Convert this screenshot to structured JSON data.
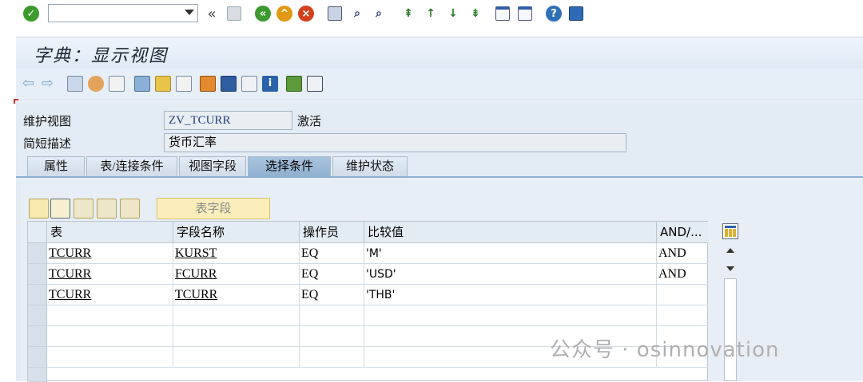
{
  "system_toolbar": {
    "command_value": "",
    "icons": [
      "check-icon",
      "back-chevrons-icon",
      "save-icon",
      "back-icon",
      "exit-icon",
      "cancel-icon",
      "print-icon",
      "find-icon",
      "find-next-icon",
      "first-page-icon",
      "prev-page-icon",
      "next-page-icon",
      "last-page-icon",
      "new-session-icon",
      "shortcut-icon",
      "help-icon",
      "customize-layout-icon"
    ]
  },
  "title": "字典：显示视图",
  "form": {
    "view_label": "维护视图",
    "view_value": "ZV_TCURR",
    "view_status": "激活",
    "desc_label": "简短描述",
    "desc_value": "货币汇率"
  },
  "tabs": [
    {
      "label": "属性",
      "active": false
    },
    {
      "label": "表/连接条件",
      "active": false
    },
    {
      "label": "视图字段",
      "active": false
    },
    {
      "label": "选择条件",
      "active": true
    },
    {
      "label": "维护状态",
      "active": false
    }
  ],
  "table_toolbar": {
    "table_field_button": "表字段"
  },
  "grid": {
    "headers": [
      "表",
      "字段名称",
      "操作员",
      "比较值",
      "AND/..."
    ],
    "rows": [
      [
        "TCURR",
        "KURST",
        "EQ",
        "'M'",
        "AND"
      ],
      [
        "TCURR",
        "FCURR",
        "EQ",
        "'USD'",
        "AND"
      ],
      [
        "TCURR",
        "TCURR",
        "EQ",
        "'THB'",
        ""
      ]
    ]
  },
  "watermark": "公众号 · osinnovation"
}
